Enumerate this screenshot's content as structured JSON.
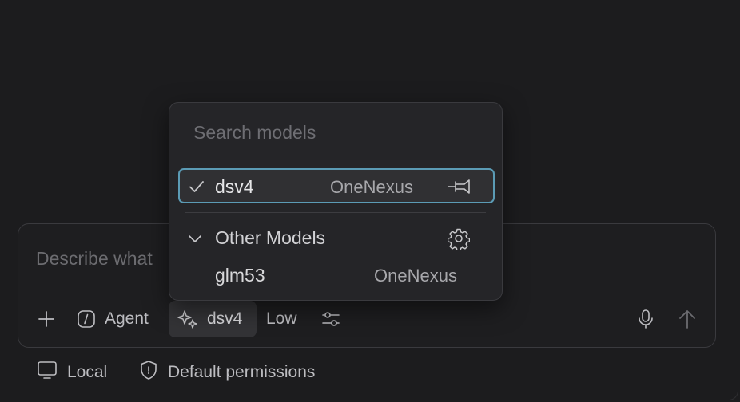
{
  "composer": {
    "placeholder": "Describe what",
    "toolbar": {
      "mode_label": "Agent",
      "model_label": "dsv4",
      "effort_label": "Low"
    }
  },
  "footer": {
    "location_label": "Local",
    "permissions_label": "Default permissions"
  },
  "model_menu": {
    "search_placeholder": "Search models",
    "selected": {
      "name": "dsv4",
      "provider": "OneNexus"
    },
    "group_label": "Other Models",
    "items": [
      {
        "name": "glm53",
        "provider": "OneNexus"
      }
    ]
  },
  "colors": {
    "background": "#1c1c1e",
    "selection_border": "#5b9bb5",
    "menu_background": "#252528"
  },
  "icons": [
    "plus-icon",
    "agent-icon",
    "sparkle-icon",
    "sliders-icon",
    "microphone-icon",
    "send-arrow-icon",
    "monitor-icon",
    "shield-icon",
    "check-icon",
    "pin-icon",
    "chevron-down-icon",
    "gear-icon"
  ]
}
